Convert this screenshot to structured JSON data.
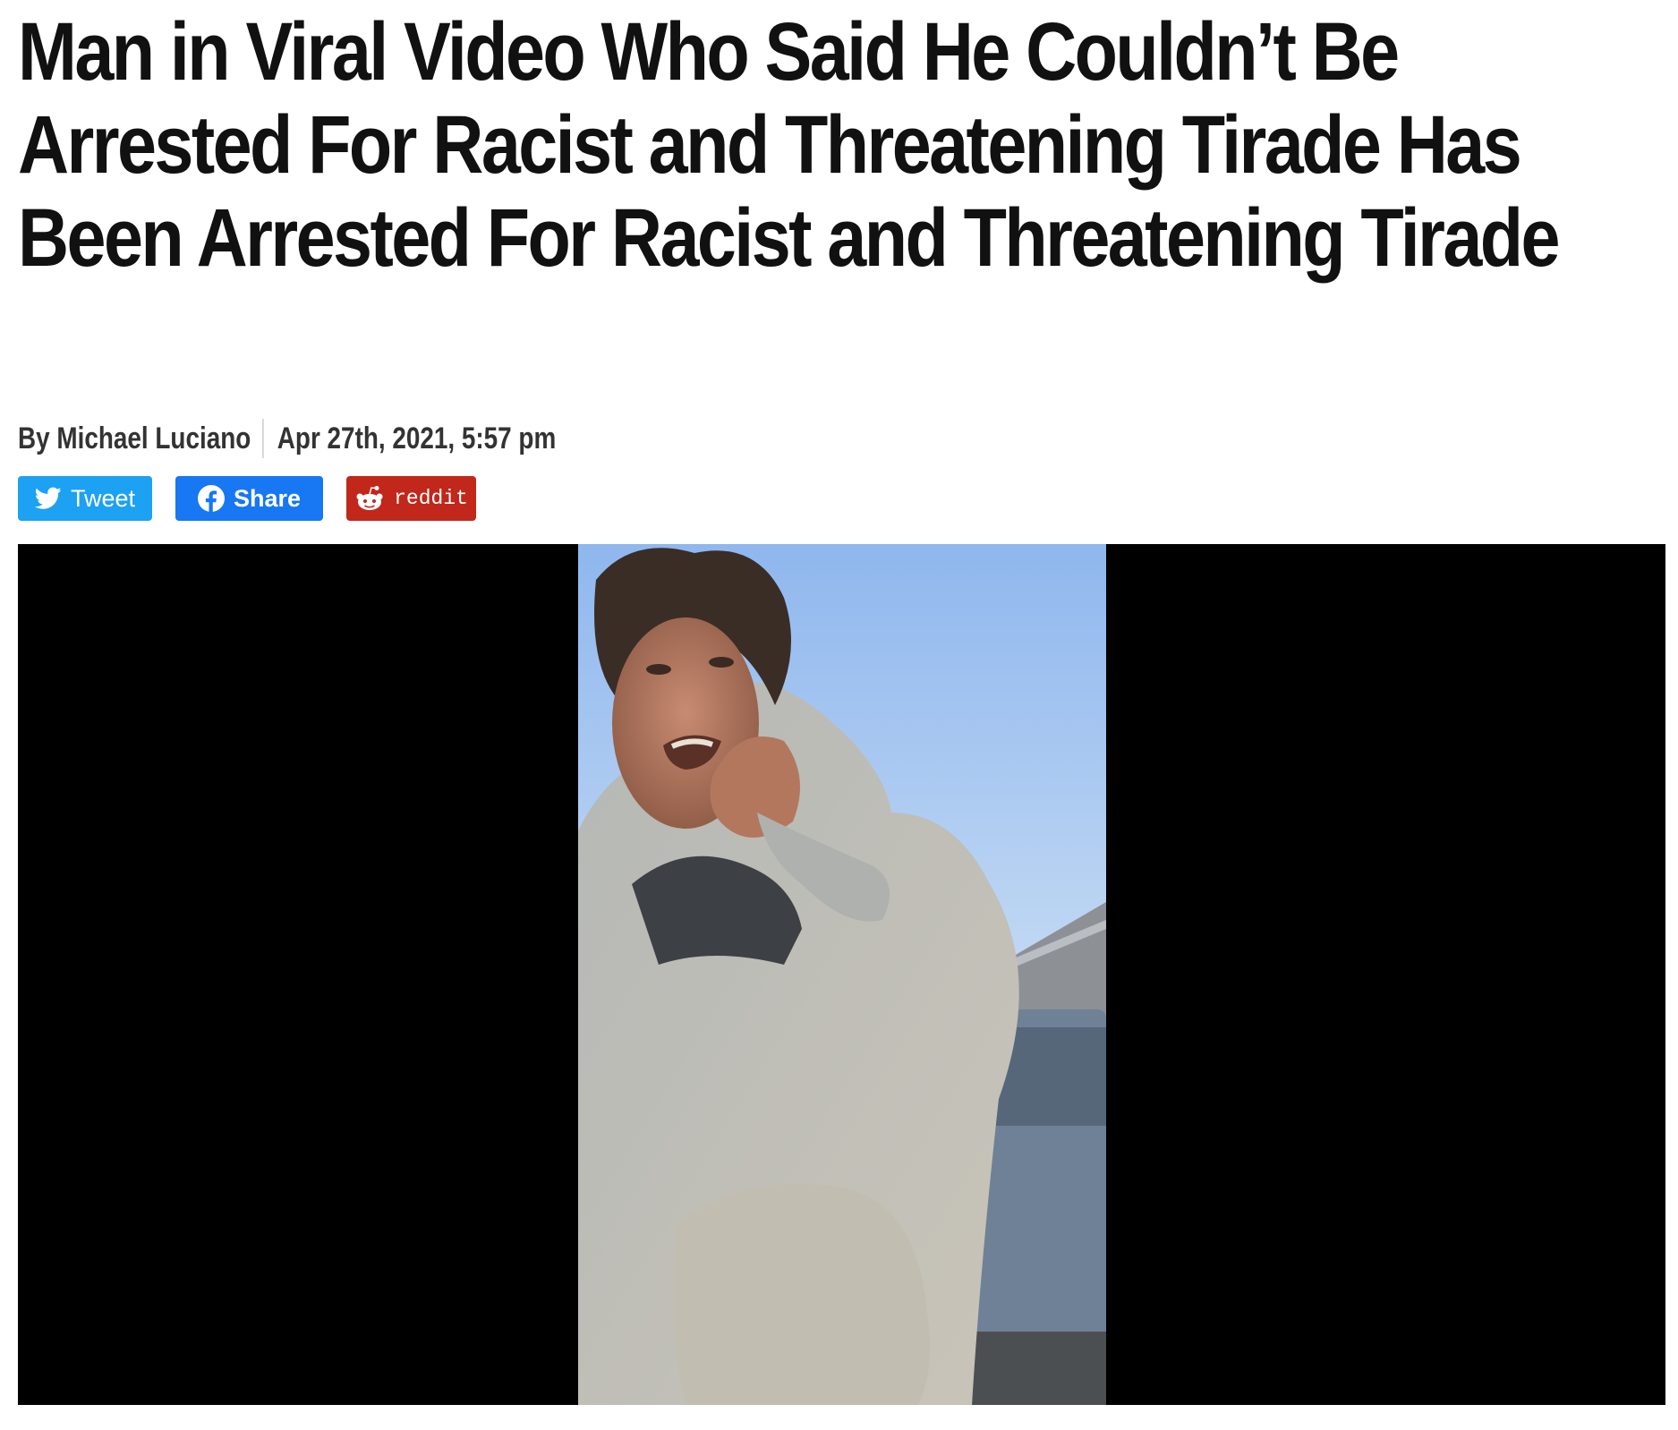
{
  "article": {
    "title": "Man in Viral Video Who Said He Couldn’t Be Arrested For Racist and Threatening Tirade Has Been Arrested For Racist and Threatening Tirade",
    "author": "By Michael Luciano",
    "date": "Apr 27th, 2021, 5:57 pm"
  },
  "share": {
    "tweet_label": "Tweet",
    "share_label": "Share",
    "reddit_label": "reddit",
    "tweet_icon": "twitter-bird-icon",
    "share_icon": "facebook-icon",
    "reddit_icon": "reddit-alien-icon",
    "colors": {
      "twitter": "#1da1f2",
      "facebook": "#1877f2",
      "reddit": "#c1271a"
    }
  },
  "video": {
    "background": "#000000"
  }
}
